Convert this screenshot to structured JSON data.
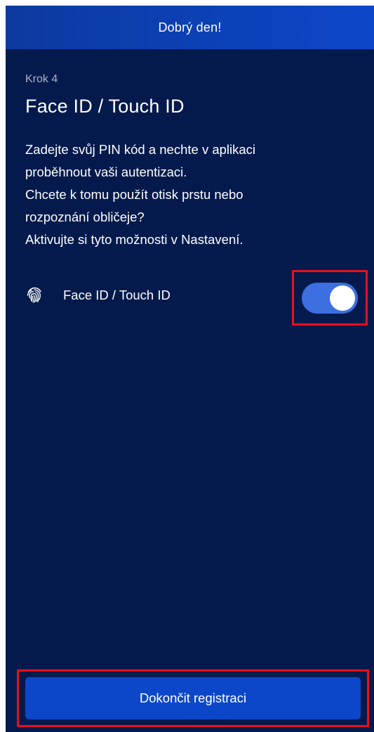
{
  "header": {
    "title": "Dobrý den!"
  },
  "main": {
    "step_label": "Krok 4",
    "title": "Face ID / Touch ID",
    "description_lines": [
      "Zadejte svůj PIN kód a nechte v aplikaci",
      "proběhnout vaši autentizaci.",
      "Chcete k tomu použít otisk prstu nebo",
      "rozpoznání obličeje?",
      "Aktivujte si tyto možnosti v Nastavení."
    ],
    "biometric_toggle": {
      "icon": "fingerprint-icon",
      "label": "Face ID / Touch ID",
      "enabled": true
    }
  },
  "footer": {
    "finish_label": "Dokončit registraci"
  },
  "colors": {
    "background": "#041a4c",
    "header": "#0d47c9",
    "accent": "#3d6fe0",
    "highlight": "#e8101c"
  }
}
